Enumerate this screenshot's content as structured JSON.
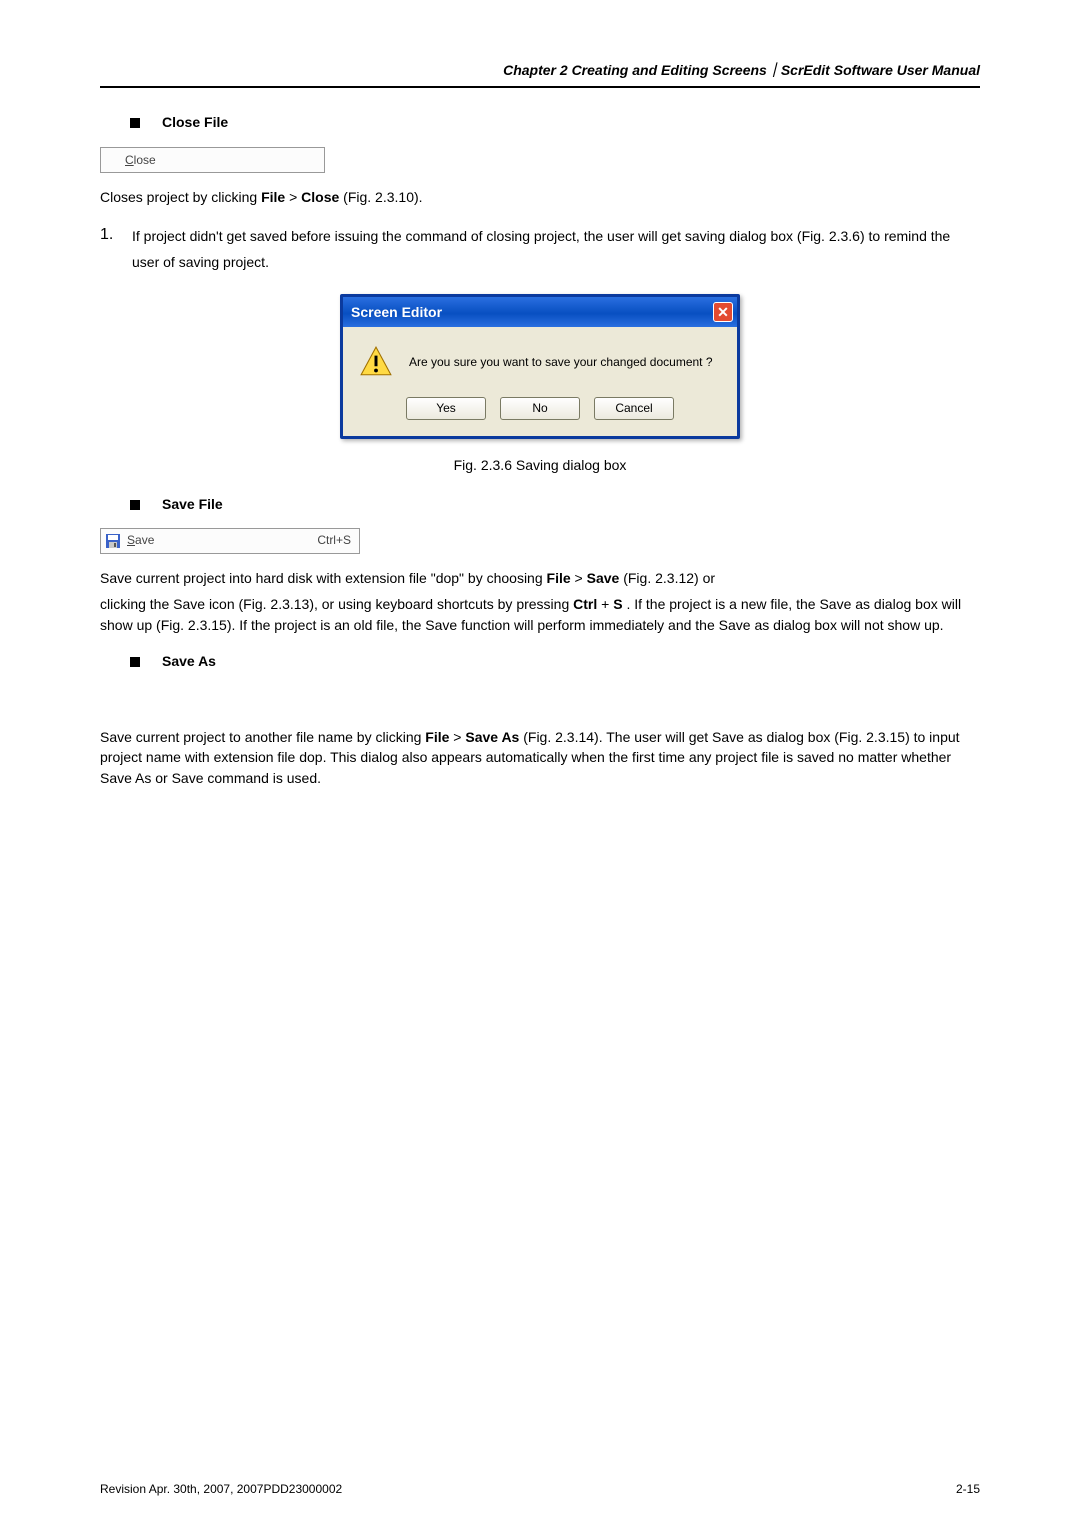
{
  "header": "Chapter 2  Creating and Editing Screens｜ScrEdit Software User Manual",
  "close_file": {
    "heading": "Close File",
    "menu_label": "Close",
    "closes_text_pre": "Closes project by clicking ",
    "closes_text_bold1": "File",
    "closes_text_gt": " > ",
    "closes_text_bold2": "Close",
    "closes_text_post": " (Fig. 2.3.10).",
    "num": "1.",
    "list_text": "If project didn't get saved before issuing the command of closing project, the user will get saving dialog box (Fig. 2.3.6) to remind the user of saving project."
  },
  "dialog": {
    "title": "Screen Editor",
    "message": "Are you sure you want to save your changed document ?",
    "yes": "Yes",
    "no": "No",
    "cancel": "Cancel"
  },
  "fig_caption": "Fig. 2.3.6 Saving dialog box",
  "save_file": {
    "heading": "Save File",
    "menu_label": "Save",
    "menu_shortcut": "Ctrl+S",
    "p1_a": "Save current project into hard disk with extension file \"dop\" by choosing ",
    "p1_b": "File",
    "p1_c": " > ",
    "p1_d": "Save",
    "p1_e": " (Fig. 2.3.12) or",
    "p2_a": "clicking the Save icon        (Fig. 2.3.13), or using keyboard shortcuts by pressing ",
    "p2_b": "Ctrl",
    "p2_c": " + ",
    "p2_d": "S",
    "p2_e": ". If the project is a new file, the Save as dialog box will show up (Fig. 2.3.15). If the project is an old file, the Save function will perform immediately and the Save as dialog box will not show up."
  },
  "save_as": {
    "heading": "Save As",
    "p_a": "Save current project to another file name by clicking ",
    "p_b": "File",
    "p_c": " > ",
    "p_d": "Save As",
    "p_e": " (Fig. 2.3.14). The user will get Save as dialog box (Fig. 2.3.15) to input project name with extension file dop. This dialog also appears automatically when the first time any project file is saved no matter whether Save As or Save command is used."
  },
  "footer": {
    "left": "Revision Apr. 30th, 2007, 2007PDD23000002",
    "right": "2-15"
  }
}
